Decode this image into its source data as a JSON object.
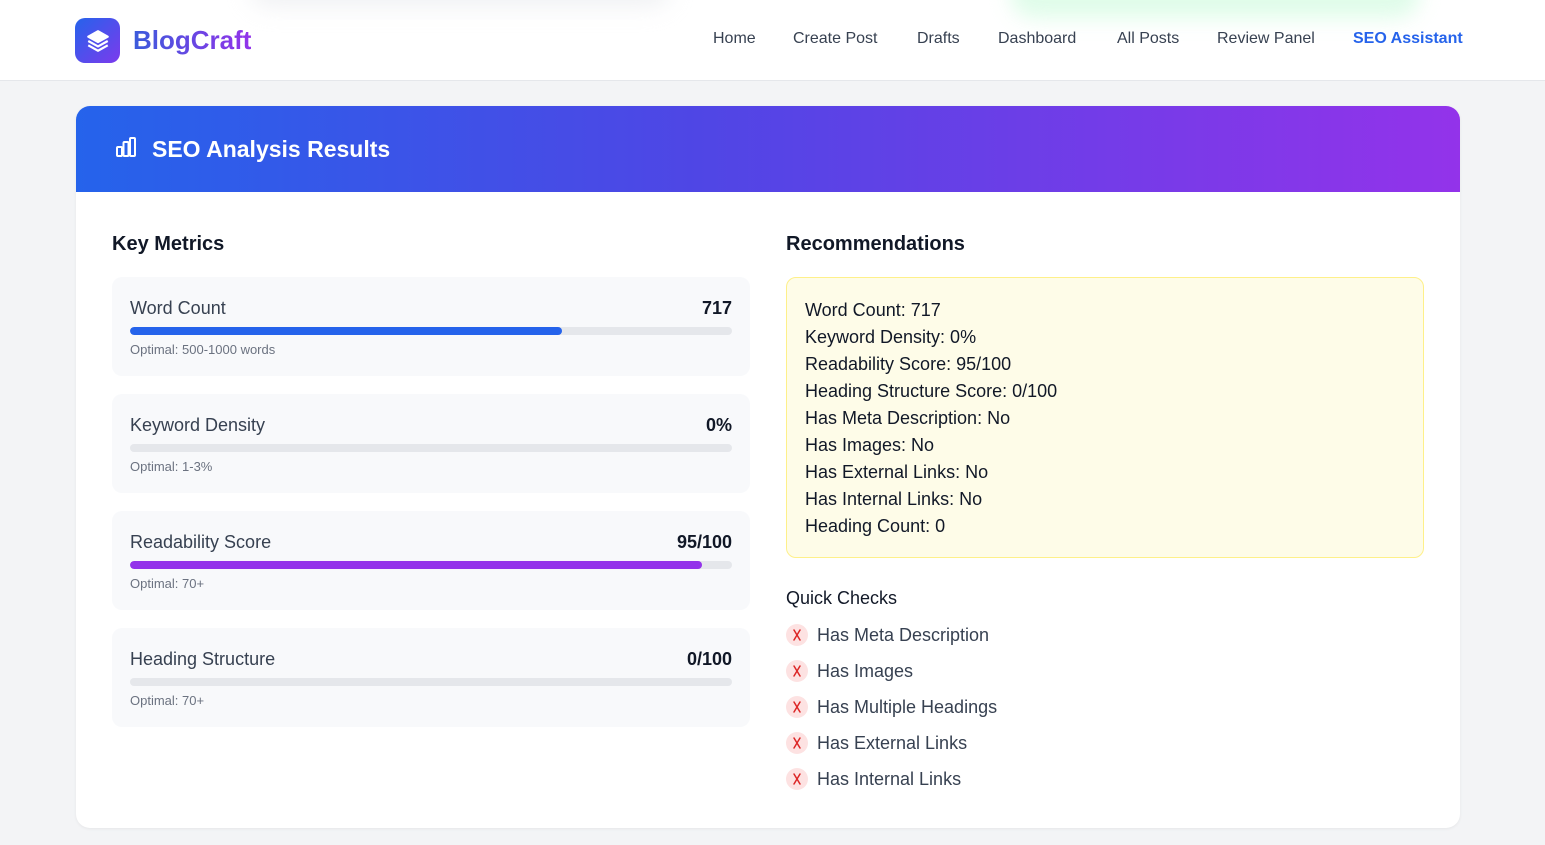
{
  "app": {
    "brand": "BlogCraft",
    "logo_icon": "layers-icon",
    "brand_gradient": [
      "#3b5bdb",
      "#9333ea"
    ]
  },
  "nav": {
    "items": [
      {
        "label": "Home"
      },
      {
        "label": "Create Post"
      },
      {
        "label": "Drafts"
      },
      {
        "label": "Dashboard"
      },
      {
        "label": "All Posts"
      },
      {
        "label": "Review Panel"
      },
      {
        "label": "SEO Assistant"
      }
    ],
    "active": "SEO Assistant",
    "active_color": "#2563eb"
  },
  "panel": {
    "title": "SEO Analysis Results",
    "icon": "bar-chart-icon",
    "header_gradient": [
      "#2563eb",
      "#4f46e5",
      "#9333ea"
    ]
  },
  "metrics": {
    "title": "Key Metrics",
    "items": [
      {
        "label": "Word Count",
        "value": "717",
        "hint": "Optimal: 500-1000 words",
        "progress": 0.717,
        "color": "#2563eb"
      },
      {
        "label": "Keyword Density",
        "value": "0%",
        "hint": "Optimal: 1-3%",
        "progress": 0,
        "color": "#2563eb"
      },
      {
        "label": "Readability Score",
        "value": "95/100",
        "hint": "Optimal: 70+",
        "progress": 0.95,
        "color": "#9333ea"
      },
      {
        "label": "Heading Structure",
        "value": "0/100",
        "hint": "Optimal: 70+",
        "progress": 0,
        "color": "#2563eb"
      }
    ]
  },
  "recommendations": {
    "title": "Recommendations",
    "lines": [
      "Word Count: 717",
      "Keyword Density: 0%",
      "Readability Score: 95/100",
      "Heading Structure Score: 0/100",
      "Has Meta Description: No",
      "Has Images: No",
      "Has External Links: No",
      "Has Internal Links: No",
      "Heading Count: 0"
    ]
  },
  "quick_checks": {
    "title": "Quick Checks",
    "status_icon": "x-mark-icon",
    "fail_color": "#dc2626",
    "items": [
      {
        "label": "Has Meta Description",
        "passed": false
      },
      {
        "label": "Has Images",
        "passed": false
      },
      {
        "label": "Has Multiple Headings",
        "passed": false
      },
      {
        "label": "Has External Links",
        "passed": false
      },
      {
        "label": "Has Internal Links",
        "passed": false
      }
    ]
  }
}
